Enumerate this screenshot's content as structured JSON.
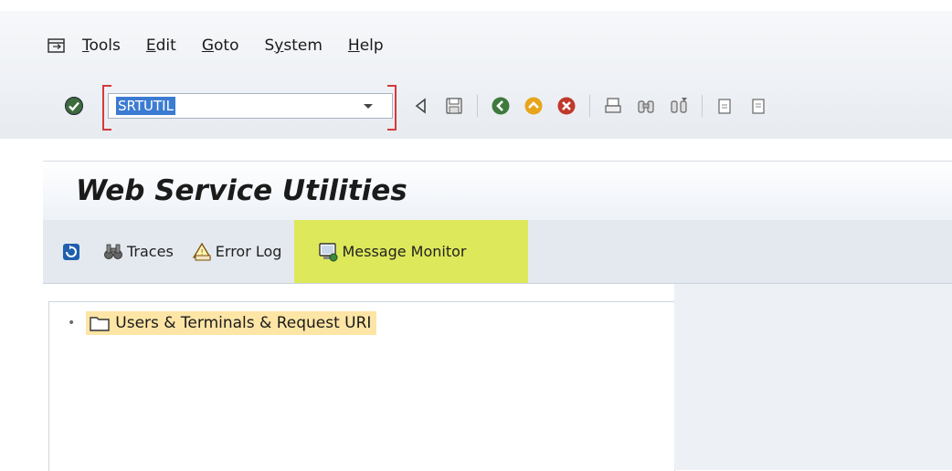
{
  "menu": {
    "exit_icon": "exit-icon",
    "items": [
      {
        "accel": "T",
        "rest": "ools"
      },
      {
        "accel": "E",
        "rest": "dit"
      },
      {
        "accel": "G",
        "rest": "oto"
      },
      {
        "pre": "S",
        "accel": "y",
        "rest": "stem"
      },
      {
        "accel": "H",
        "rest": "elp"
      }
    ]
  },
  "command_field": {
    "value": "SRTUTIL"
  },
  "page": {
    "title": "Web Service Utilities"
  },
  "app_toolbar": {
    "refresh_icon": "refresh-icon",
    "traces_label": "Traces",
    "error_log_label": "Error Log",
    "message_monitor_label": "Message Monitor",
    "highlight_color": "#dde85a"
  },
  "tree": {
    "nodes": [
      {
        "label": "Users & Terminals & Request URI",
        "icon": "folder-icon"
      }
    ]
  },
  "colors": {
    "accent": "#3b7bd2",
    "node_highlight": "#fde5a6",
    "command_bracket": "#d43a3a"
  }
}
